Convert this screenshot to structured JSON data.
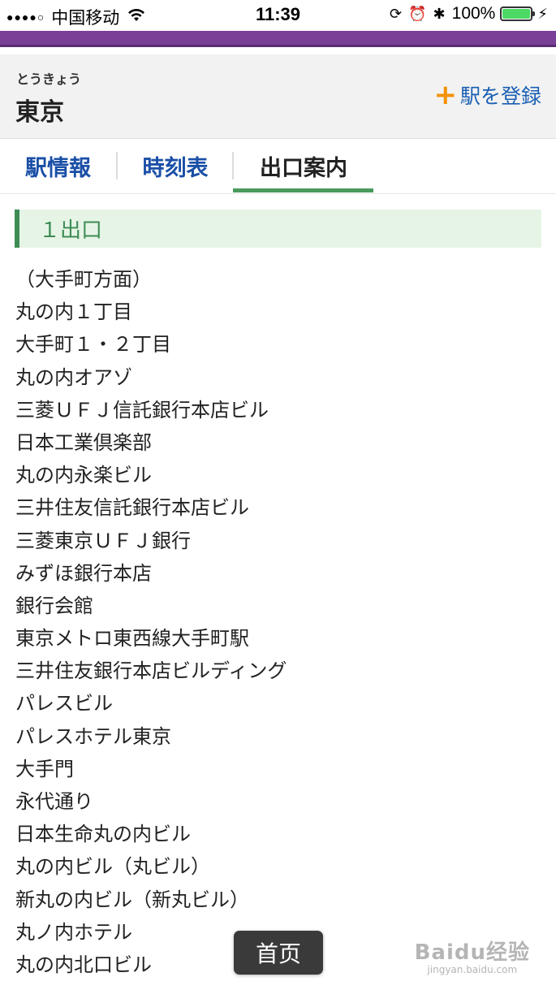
{
  "status_bar": {
    "signal": "●●●●○",
    "carrier": "中国移动",
    "time": "11:39",
    "battery_percent": "100%",
    "battery_level": 1.0
  },
  "station": {
    "reading": "とうきょう",
    "name": "東京",
    "register_label": "駅を登録"
  },
  "tabs": [
    {
      "label": "駅情報",
      "active": false
    },
    {
      "label": "時刻表",
      "active": false
    },
    {
      "label": "出口案内",
      "active": true
    }
  ],
  "exit": {
    "heading": "１出口",
    "items": [
      "（大手町方面）",
      "丸の内１丁目",
      "大手町１・２丁目",
      "丸の内オアゾ",
      "三菱ＵＦＪ信託銀行本店ビル",
      "日本工業倶楽部",
      "丸の内永楽ビル",
      "三井住友信託銀行本店ビル",
      "三菱東京ＵＦＪ銀行",
      "みずほ銀行本店",
      "銀行会館",
      "東京メトロ東西線大手町駅",
      "三井住友銀行本店ビルディング",
      "パレスビル",
      "パレスホテル東京",
      "大手門",
      "永代通り",
      "日本生命丸の内ビル",
      "丸の内ビル（丸ビル）",
      "新丸の内ビル（新丸ビル）",
      "丸ノ内ホテル",
      "丸の内北口ビル"
    ]
  },
  "home_button": {
    "label": "首页"
  },
  "watermark": {
    "logo": "Baidu经验",
    "url": "jingyan.baidu.com"
  },
  "colors": {
    "purple": "#7a3f97",
    "tab_blue": "#1a4fa6",
    "accent_green": "#3d8c55",
    "plus_orange": "#f39200"
  }
}
